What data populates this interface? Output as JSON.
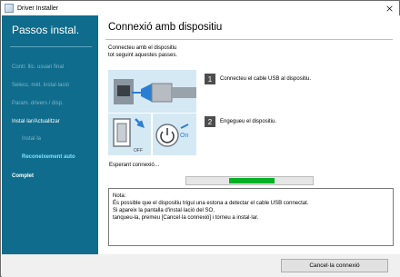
{
  "window": {
    "title": "Driver Installer"
  },
  "sidebar": {
    "heading": "Passos instal.",
    "items": [
      {
        "label": "Contr. llic. usuari final",
        "state": "inactive"
      },
      {
        "label": "Selecc. mèt. instal·lació",
        "state": "inactive"
      },
      {
        "label": "Param. drivers / disp.",
        "state": "inactive"
      },
      {
        "label": "Instal·lar/Actualitzar",
        "state": "active"
      },
      {
        "label": "Instal·la",
        "state": "inactive"
      },
      {
        "label": "Reconeixement auto",
        "state": "current"
      },
      {
        "label": "Complet",
        "state": "done"
      }
    ]
  },
  "main": {
    "title": "Connexió amb dispositiu",
    "intro_line1": "Connecteu amb el dispositiu",
    "intro_line2": "tot seguint aquestes passes.",
    "steps": [
      {
        "number": "1",
        "text": "Connecteu el cable USB al dispositiu."
      },
      {
        "number": "2",
        "text": "Engegueu el dispositiu."
      }
    ],
    "illustration": {
      "off_label": "OFF",
      "on_label": "On"
    },
    "status": "Esperant connexió…",
    "progress": {
      "fraction": 0.36,
      "offset_fraction": 0.34,
      "color": "#06b025"
    },
    "note": {
      "line1": "Nota:",
      "line2": "És possible que el dispositiu trigui una estona a detectar el cable USB connectat.",
      "line3": "Si apareix la pantalla d'instal·lació del SO,",
      "line4": "tanqueu-la, premeu [Cancel·la connexió] i torneu a instal·lar."
    }
  },
  "footer": {
    "cancel_label": "Cancel·la connexió"
  },
  "colors": {
    "sidebar_bg": "#0f6c8c",
    "accent": "#7ee2ff",
    "illus_bg": "#d5e9f4"
  }
}
